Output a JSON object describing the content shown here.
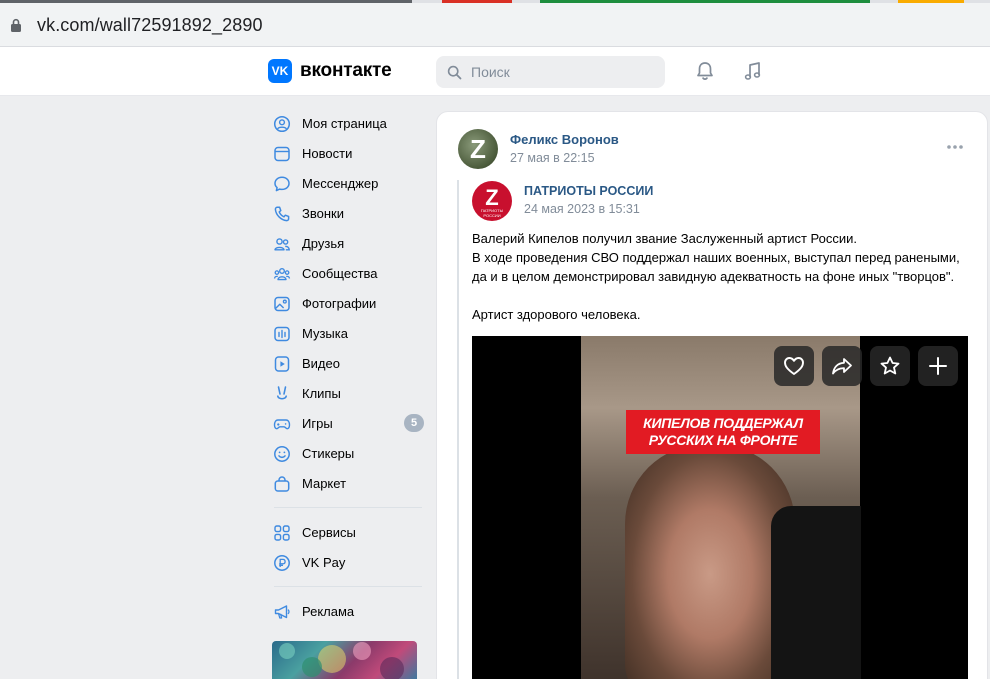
{
  "browser": {
    "url": "vk.com/wall72591892_2890"
  },
  "header": {
    "logo_text": "VK",
    "wordmark": "вконтакте",
    "search_placeholder": "Поиск"
  },
  "sidebar": {
    "items": [
      {
        "label": "Моя страница",
        "icon": "user-circle-icon"
      },
      {
        "label": "Новости",
        "icon": "news-icon"
      },
      {
        "label": "Мессенджер",
        "icon": "message-icon"
      },
      {
        "label": "Звонки",
        "icon": "phone-icon"
      },
      {
        "label": "Друзья",
        "icon": "friends-icon"
      },
      {
        "label": "Сообщества",
        "icon": "communities-icon"
      },
      {
        "label": "Фотографии",
        "icon": "photo-icon"
      },
      {
        "label": "Музыка",
        "icon": "music-icon"
      },
      {
        "label": "Видео",
        "icon": "video-icon"
      },
      {
        "label": "Клипы",
        "icon": "clips-icon"
      },
      {
        "label": "Игры",
        "icon": "gamepad-icon",
        "badge": "5"
      },
      {
        "label": "Стикеры",
        "icon": "sticker-icon"
      },
      {
        "label": "Маркет",
        "icon": "market-icon"
      },
      {
        "label": "Сервисы",
        "icon": "services-icon"
      },
      {
        "label": "VK Pay",
        "icon": "vkpay-icon"
      },
      {
        "label": "Реклама",
        "icon": "megaphone-icon"
      }
    ]
  },
  "post": {
    "author": "Феликс Воронов",
    "author_avatar_letter": "Z",
    "date": "27 мая в 22:15",
    "repost": {
      "group_name": "ПАТРИОТЫ РОССИИ",
      "group_avatar_letter": "Z",
      "group_avatar_caption": "ПАТРИОТЫ РОССИИ",
      "date": "24 мая 2023 в 15:31",
      "text_lines": [
        "Валерий Кипелов получил звание Заслуженный артист России.",
        "В ходе проведения СВО поддержал наших военных, выступал перед ранеными,",
        "да и в целом демонстрировал завидную адекватность на фоне иных \"творцов\".",
        "Артист здорового человека."
      ],
      "video_banner": [
        "КИПЕЛОВ ПОДДЕРЖАЛ",
        "РУССКИХ НА ФРОНТЕ"
      ]
    }
  },
  "colors": {
    "accent": "#0077ff",
    "link": "#2a5885",
    "muted": "#818c99",
    "banner_red": "#e21b23"
  }
}
